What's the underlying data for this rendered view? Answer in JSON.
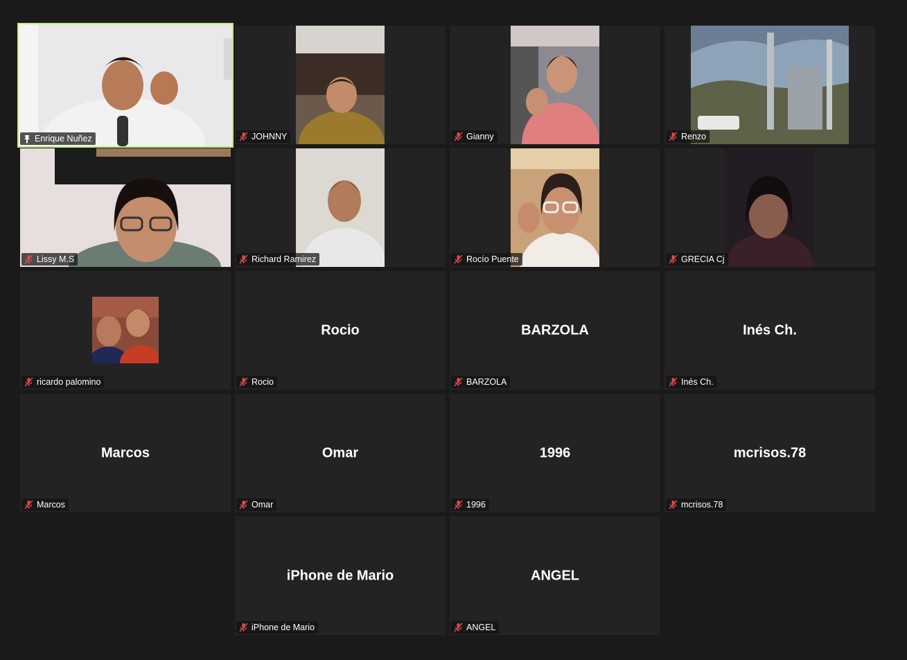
{
  "meeting": {
    "participants": [
      {
        "name": "Enrique Nuñez",
        "video": true,
        "pinned": true,
        "active": true
      },
      {
        "name": "JOHNNY",
        "video": true
      },
      {
        "name": "Gianny",
        "video": true
      },
      {
        "name": "Renzo",
        "video": true
      },
      {
        "name": "Lissy M.S",
        "video": true
      },
      {
        "name": "Richard Ramirez",
        "video": true
      },
      {
        "name": "Rocío Puente",
        "video": true
      },
      {
        "name": "GRECIA Cj",
        "video": true
      },
      {
        "name": "ricardo palomino",
        "video": false,
        "profile_photo": true
      },
      {
        "name": "Rocio",
        "video": false
      },
      {
        "name": "BARZOLA",
        "video": false
      },
      {
        "name": "Inés Ch.",
        "video": false
      },
      {
        "name": "Marcos",
        "video": false
      },
      {
        "name": "Omar",
        "video": false
      },
      {
        "name": "1996",
        "video": false
      },
      {
        "name": "mcrisos.78",
        "video": false
      },
      {
        "name": "iPhone de Mario",
        "video": false
      },
      {
        "name": "ANGEL",
        "video": false
      }
    ],
    "icons": {
      "muted": "mic-muted-icon",
      "pinned": "pin-icon"
    },
    "colors": {
      "active_speaker": "#c4ec7a",
      "muted_icon": "#e0484f",
      "tile_bg": "#232323",
      "page_bg": "#1a1a1a"
    }
  }
}
